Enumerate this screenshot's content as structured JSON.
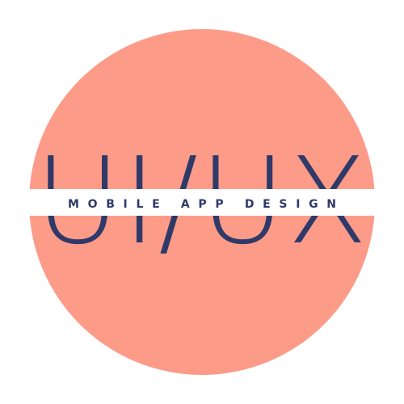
{
  "logo": {
    "main_text": "UI/UX",
    "tagline": "MOBILE APP DESIGN"
  },
  "colors": {
    "background": "#ffffff",
    "circle": "#fd9b89",
    "text": "#2f3a68",
    "band": "#ffffff"
  }
}
